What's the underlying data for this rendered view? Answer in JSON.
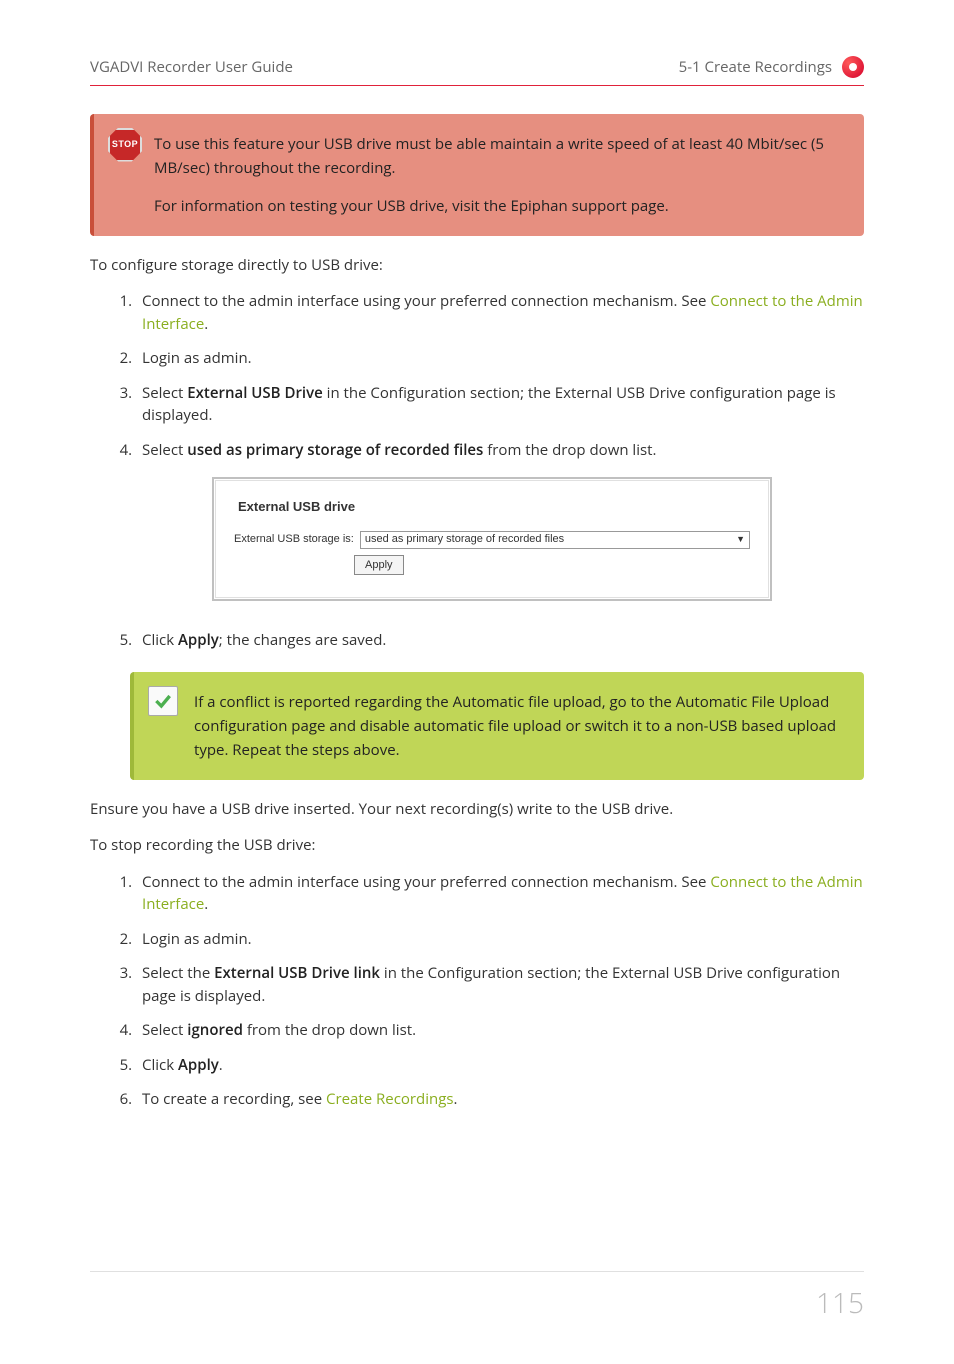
{
  "header": {
    "left": "VGADVI Recorder User Guide",
    "right": "5-1 Create Recordings"
  },
  "stop_callout": {
    "icon_label": "STOP",
    "p1": "To use this feature your USB drive must be able maintain a write speed of at least 40 Mbit/sec (5 MB/sec) throughout the recording.",
    "p2": "For information on testing your USB drive, visit the Epiphan support page."
  },
  "intro1": "To configure storage directly to USB drive:",
  "steps1": {
    "s1_pre": "Connect to the admin interface using your preferred connection mechanism. See ",
    "s1_link": "Connect to the Admin Interface",
    "s1_post": ".",
    "s2": "Login as admin.",
    "s3_pre": "Select ",
    "s3_bold": "External USB Drive",
    "s3_post": " in the Configuration section; the External USB Drive configuration page is displayed.",
    "s4_pre": "Select ",
    "s4_bold": "used as primary storage of recorded files",
    "s4_post": " from the drop down list.",
    "s5_pre": "Click ",
    "s5_bold": "Apply",
    "s5_post": "; the changes are saved."
  },
  "screenshot": {
    "title": "External USB drive",
    "label": "External USB storage is:",
    "select_value": "used as primary storage of recorded files",
    "apply_label": "Apply"
  },
  "ok_callout": {
    "text": "If a conflict is reported regarding the Automatic file upload, go to the Automatic File Upload configuration page and disable automatic file upload or switch it to a non-USB based upload type. Repeat the steps above."
  },
  "body2": "Ensure you have a USB drive inserted. Your next recording(s) write to the USB drive.",
  "intro2": "To stop recording the USB drive:",
  "steps2": {
    "s1_pre": "Connect to the admin interface using your preferred connection mechanism. See ",
    "s1_link": "Connect to the Admin Interface",
    "s1_post": ".",
    "s2": "Login as admin.",
    "s3_pre": "Select the ",
    "s3_bold": "External USB Drive link",
    "s3_post": " in the Configuration section; the External USB Drive configuration page is displayed.",
    "s4_pre": "Select ",
    "s4_bold": "ignored",
    "s4_post": " from the drop down list.",
    "s5_pre": "Click ",
    "s5_bold": "Apply",
    "s5_post": ".",
    "s6_pre": "To create a recording, see ",
    "s6_link": "Create Recordings",
    "s6_post": "."
  },
  "page_number": "115"
}
